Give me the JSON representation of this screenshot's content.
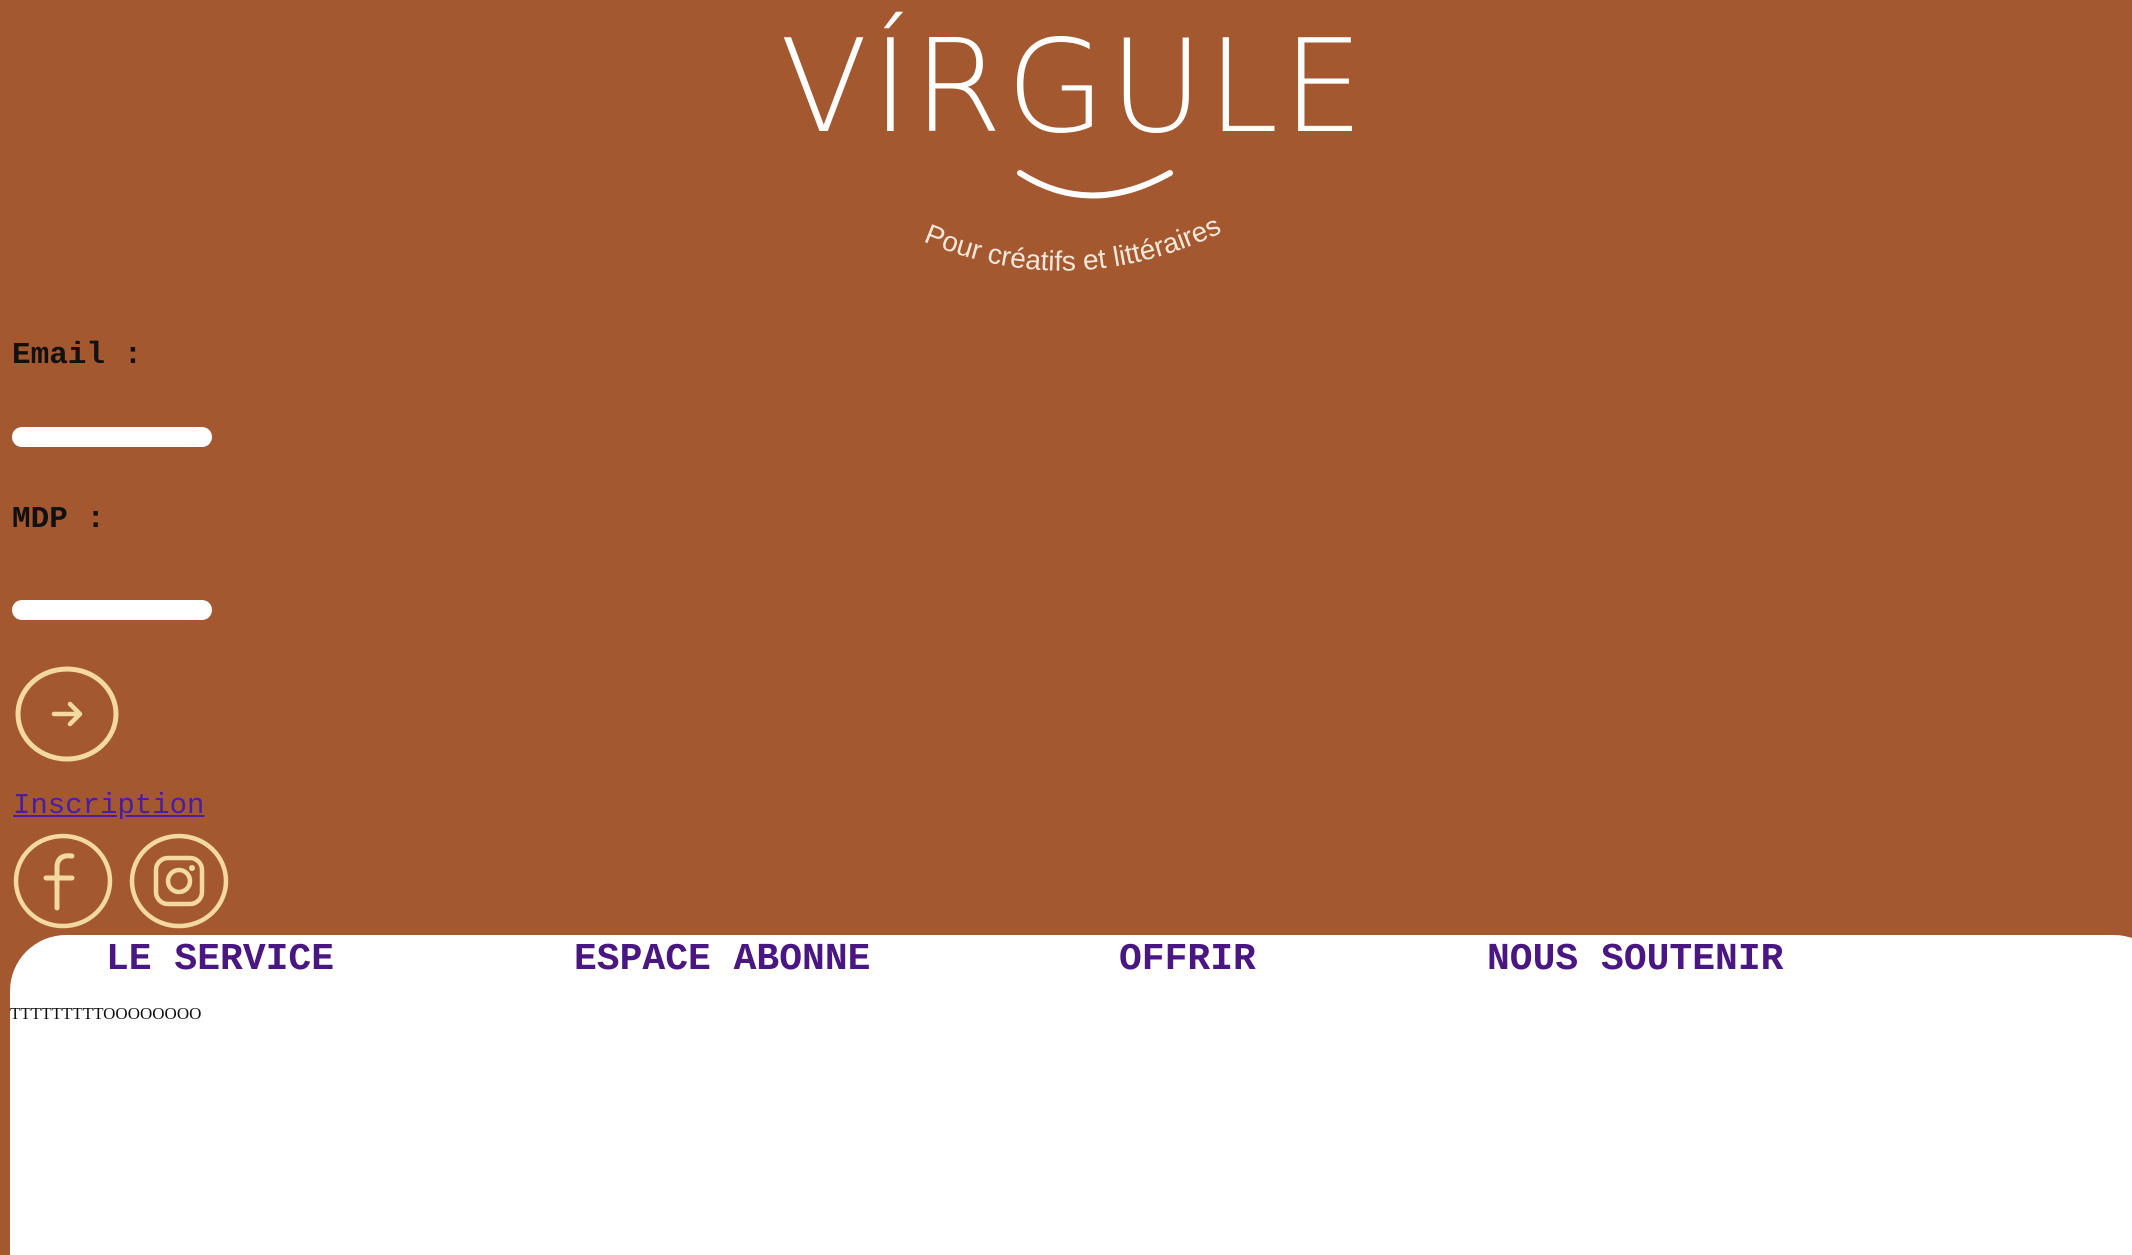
{
  "brand": {
    "name": "VÍRGULE",
    "tagline": "Pour créatifs et littéraires"
  },
  "login": {
    "email_label": "Email :",
    "email_value": "",
    "password_label": "MDP :",
    "password_value": "",
    "submit_icon": "arrow-right-icon",
    "signup_link": "Inscription"
  },
  "social": [
    {
      "name": "facebook",
      "icon": "facebook-icon"
    },
    {
      "name": "instagram",
      "icon": "instagram-icon"
    }
  ],
  "nav": {
    "items": [
      "LE SERVICE",
      "ESPACE ABONNE",
      "OFFRIR",
      "NOUS SOUTENIR"
    ]
  },
  "content": {
    "text": "TTTTTTTTTOOOOOOOO"
  },
  "colors": {
    "background": "#a35830",
    "accent": "#f3d8a0",
    "nav_text": "#4a1682",
    "link": "#4a1ea0",
    "panel": "#ffffff"
  }
}
